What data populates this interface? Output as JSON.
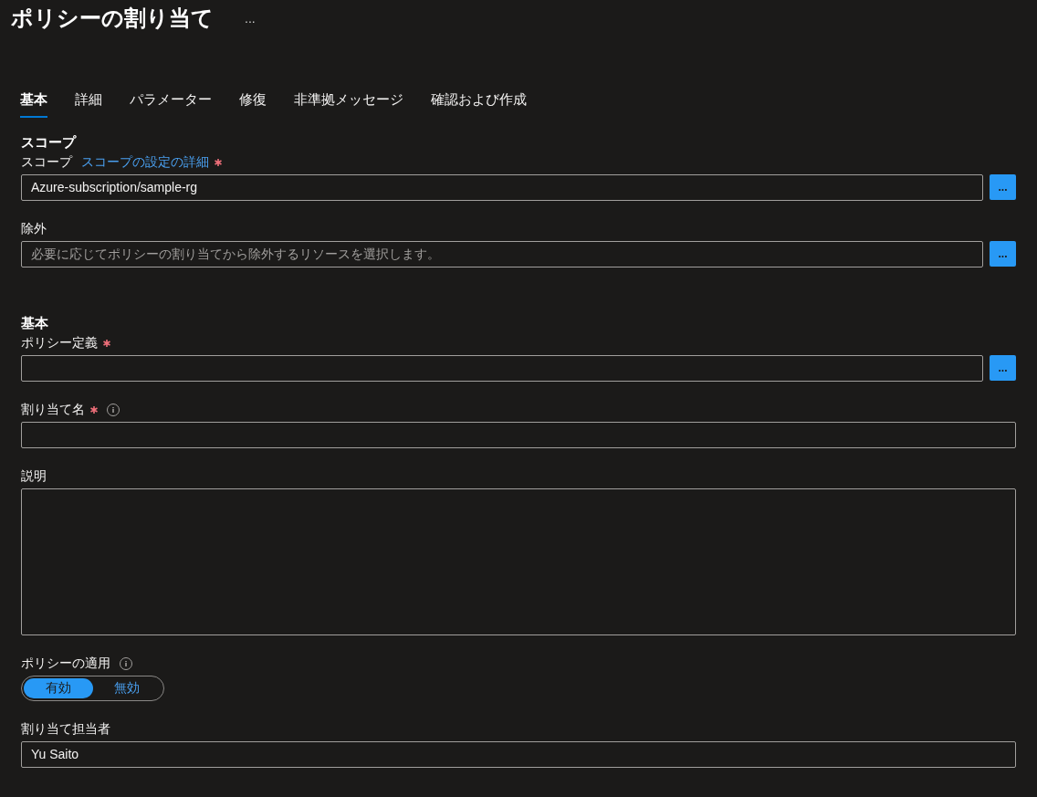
{
  "page": {
    "title": "ポリシーの割り当て",
    "more": "..."
  },
  "tabs": [
    {
      "label": "基本",
      "selected": true
    },
    {
      "label": "詳細",
      "selected": false
    },
    {
      "label": "パラメーター",
      "selected": false
    },
    {
      "label": "修復",
      "selected": false
    },
    {
      "label": "非準拠メッセージ",
      "selected": false
    },
    {
      "label": "確認および作成",
      "selected": false
    }
  ],
  "sections": [
    {
      "heading": "スコープ",
      "fields": [
        {
          "kind": "picker",
          "label": "スコープ",
          "link": "スコープの設定の詳細",
          "required": true,
          "info": false,
          "value": "Azure-subscription/sample-rg",
          "button": "..."
        },
        {
          "kind": "picker",
          "label": "除外",
          "required": false,
          "info": false,
          "placeholder": "必要に応じてポリシーの割り当てから除外するリソースを選択します。",
          "button": "..."
        }
      ]
    },
    {
      "heading": "基本",
      "fields": [
        {
          "kind": "picker",
          "label": "ポリシー定義",
          "required": true,
          "info": false,
          "button": "..."
        },
        {
          "kind": "text",
          "label": "割り当て名",
          "required": true,
          "info": true
        },
        {
          "kind": "textarea",
          "label": "説明",
          "required": false,
          "info": false
        },
        {
          "kind": "toggle",
          "label": "ポリシーの適用",
          "required": false,
          "info": true,
          "options": [
            {
              "label": "有効",
              "selected": true
            },
            {
              "label": "無効",
              "selected": false
            }
          ]
        },
        {
          "kind": "text",
          "label": "割り当て担当者",
          "required": false,
          "info": false,
          "value": "Yu Saito"
        }
      ]
    }
  ]
}
